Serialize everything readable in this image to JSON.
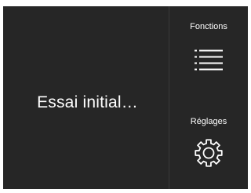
{
  "main": {
    "status_text": "Essai initial…"
  },
  "side_panel": {
    "functions_label": "Fonctions",
    "functions_icon": "list-icon",
    "settings_label": "Réglages",
    "settings_icon": "gear-icon"
  },
  "colors": {
    "background": "#262626",
    "text": "#ffffff"
  }
}
